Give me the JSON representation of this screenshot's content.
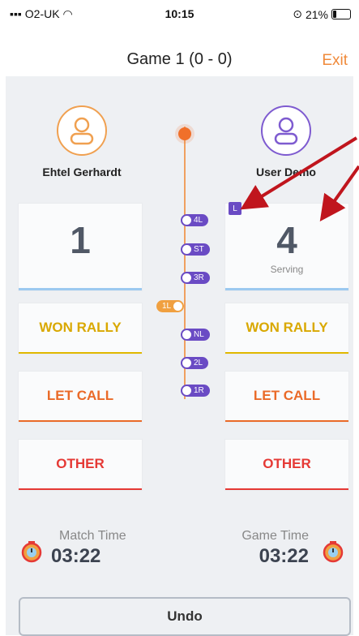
{
  "status_bar": {
    "carrier": "O2-UK",
    "time": "10:15",
    "battery": "21%"
  },
  "header": {
    "title": "Game 1 (0 - 0)",
    "exit_label": "Exit"
  },
  "players": {
    "left": {
      "name": "Ehtel Gerhardt",
      "score": "1",
      "serving": ""
    },
    "right": {
      "name": "User Demo",
      "score": "4",
      "serving": "Serving"
    }
  },
  "actions": {
    "won": "WON RALLY",
    "let": "LET CALL",
    "other": "OTHER"
  },
  "timeline": {
    "right_pills": [
      "4L",
      "ST",
      "3R",
      "NL",
      "2L",
      "1R"
    ],
    "left_pill": "1L",
    "serve_badge": "L"
  },
  "timers": {
    "match_label": "Match Time",
    "match_value": "03:22",
    "game_label": "Game Time",
    "game_value": "03:22"
  },
  "undo_label": "Undo",
  "colors": {
    "accent_orange": "#f08a3a",
    "accent_purple": "#6a4bc4",
    "annotation_arrow": "#c0151d"
  }
}
